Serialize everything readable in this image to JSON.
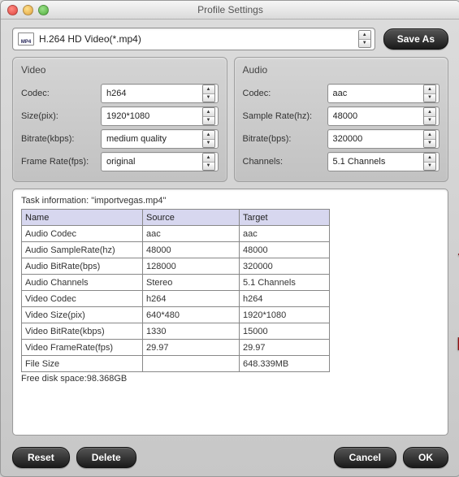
{
  "window": {
    "title": "Profile Settings"
  },
  "profile": {
    "icon_label": "MP4",
    "selected": "H.264 HD Video(*.mp4)",
    "save_as": "Save As"
  },
  "video": {
    "title": "Video",
    "codec_label": "Codec:",
    "codec": "h264",
    "size_label": "Size(pix):",
    "size": "1920*1080",
    "bitrate_label": "Bitrate(kbps):",
    "bitrate": "medium quality",
    "framerate_label": "Frame Rate(fps):",
    "framerate": "original"
  },
  "audio": {
    "title": "Audio",
    "codec_label": "Codec:",
    "codec": "aac",
    "samplerate_label": "Sample Rate(hz):",
    "samplerate": "48000",
    "bitrate_label": "Bitrate(bps):",
    "bitrate": "320000",
    "channels_label": "Channels:",
    "channels": "5.1 Channels"
  },
  "task": {
    "header_prefix": "Task information: ",
    "filename": "\"importvegas.mp4\"",
    "col_name": "Name",
    "col_source": "Source",
    "col_target": "Target",
    "rows": [
      {
        "n": "Audio Codec",
        "s": "aac",
        "t": "aac"
      },
      {
        "n": "Audio SampleRate(hz)",
        "s": "48000",
        "t": "48000"
      },
      {
        "n": "Audio BitRate(bps)",
        "s": "128000",
        "t": "320000"
      },
      {
        "n": "Audio Channels",
        "s": "Stereo",
        "t": "5.1 Channels"
      },
      {
        "n": "Video Codec",
        "s": "h264",
        "t": "h264"
      },
      {
        "n": "Video Size(pix)",
        "s": "640*480",
        "t": "1920*1080"
      },
      {
        "n": "Video BitRate(kbps)",
        "s": "1330",
        "t": "15000"
      },
      {
        "n": "Video FrameRate(fps)",
        "s": "29.97",
        "t": "29.97"
      },
      {
        "n": "File Size",
        "s": "",
        "t": "648.339MB"
      }
    ],
    "free_space": "Free disk space:98.368GB"
  },
  "footer": {
    "reset": "Reset",
    "delete": "Delete",
    "cancel": "Cancel",
    "ok": "OK"
  }
}
